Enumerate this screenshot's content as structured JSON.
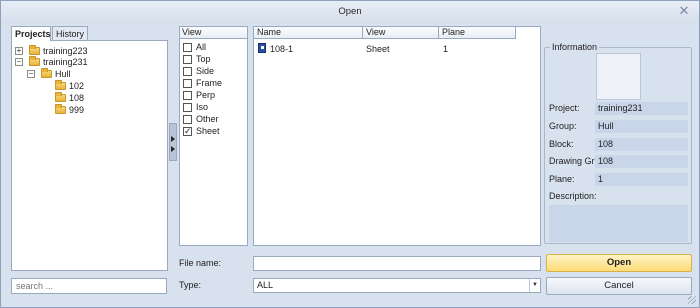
{
  "window": {
    "title": "Open"
  },
  "tabs": [
    "Projects",
    "History"
  ],
  "tree": {
    "items": [
      {
        "label": "training223",
        "expander": "+"
      },
      {
        "label": "training231",
        "expander": "−"
      },
      {
        "label": "Hull",
        "expander": "−"
      },
      {
        "label": "102"
      },
      {
        "label": "108"
      },
      {
        "label": "999"
      }
    ]
  },
  "search": {
    "placeholder": "search ..."
  },
  "view_filter": {
    "header": "View",
    "options": [
      {
        "label": "All",
        "checked": false
      },
      {
        "label": "Top",
        "checked": false
      },
      {
        "label": "Side",
        "checked": false
      },
      {
        "label": "Frame",
        "checked": false
      },
      {
        "label": "Perp",
        "checked": false
      },
      {
        "label": "Iso",
        "checked": false
      },
      {
        "label": "Other",
        "checked": false
      },
      {
        "label": "Sheet",
        "checked": true
      }
    ]
  },
  "file_list": {
    "columns": [
      "Name",
      "View",
      "Plane"
    ],
    "rows": [
      {
        "name": "108-1",
        "view": "Sheet",
        "plane": "1"
      }
    ]
  },
  "info": {
    "legend": "Information",
    "fields": [
      {
        "label": "Project:",
        "value": "training231"
      },
      {
        "label": "Group:",
        "value": "Hull"
      },
      {
        "label": "Block:",
        "value": "108"
      },
      {
        "label": "Drawing Gr:",
        "value": "108"
      },
      {
        "label": "Plane:",
        "value": "1"
      },
      {
        "label": "Description:",
        "value": ""
      }
    ]
  },
  "bottom": {
    "filename_label": "File name:",
    "filename_value": "",
    "type_label": "Type:",
    "type_value": "ALL"
  },
  "buttons": {
    "open": "Open",
    "cancel": "Cancel"
  },
  "colors": {
    "open_button": "#fddc77",
    "window_bg": "#d8e1ee",
    "info_value_bg": "#c9d6ea"
  }
}
